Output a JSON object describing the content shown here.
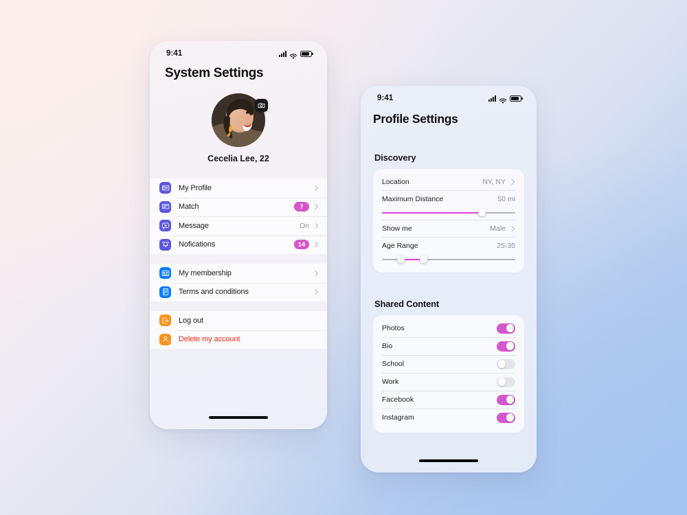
{
  "theme": {
    "bg_start": "#fbeeec",
    "bg_end": "#a4c4ee",
    "badge_color": "#d456c8",
    "toggle_on_color": "#d557cf",
    "slider_fill_color": "#e040e0",
    "icon_indigo": "#5b57e0",
    "icon_blue": "#0a7cff",
    "icon_orange": "#f79420",
    "danger_color": "#f2271c"
  },
  "phone_one": {
    "status": {
      "time": "9:41",
      "signal_icon": "signal-bars-icon",
      "wifi_icon": "wifi-icon",
      "battery_icon": "battery-icon"
    },
    "title": "System Settings",
    "avatar": {
      "name": "avatar",
      "camera_badge": "camera-icon"
    },
    "user_name": "Cecelia Lee, 22",
    "groups": [
      {
        "items": [
          {
            "label": "My Profile",
            "icon": "profile-card-icon",
            "icon_color": "#5b57e0",
            "value": "",
            "badge": "",
            "chevron": true
          },
          {
            "label": "Match",
            "icon": "match-card-icon",
            "icon_color": "#5b57e0",
            "value": "",
            "badge": "7",
            "chevron": true
          },
          {
            "label": "Message",
            "icon": "message-heart-icon",
            "icon_color": "#5b57e0",
            "value": "On",
            "badge": "",
            "chevron": true
          },
          {
            "label": "Nofications",
            "icon": "bell-ring-icon",
            "icon_color": "#5b57e0",
            "value": "",
            "badge": "14",
            "chevron": true
          }
        ]
      },
      {
        "items": [
          {
            "label": "My membership",
            "icon": "membership-card-icon",
            "icon_color": "#0a7cff",
            "value": "",
            "badge": "",
            "chevron": true
          },
          {
            "label": "Terms and conditions",
            "icon": "document-icon",
            "icon_color": "#0a7cff",
            "value": "",
            "badge": "",
            "chevron": true
          }
        ]
      },
      {
        "items": [
          {
            "label": "Log out",
            "icon": "logout-icon",
            "icon_color": "#f79420",
            "value": "",
            "badge": "",
            "chevron": false
          },
          {
            "label": "Delete my account",
            "icon": "delete-account-icon",
            "icon_color": "#f79420",
            "value": "",
            "badge": "",
            "chevron": false,
            "danger": true
          }
        ]
      }
    ],
    "home_indicator": "home-indicator"
  },
  "phone_two": {
    "status": {
      "time": "9:41",
      "signal_icon": "signal-bars-icon",
      "wifi_icon": "wifi-icon",
      "battery_icon": "battery-icon"
    },
    "title": "Profile Settings",
    "discovery": {
      "section_label": "Discovery",
      "location": {
        "label": "Location",
        "value": "NY, NY"
      },
      "max_distance": {
        "label": "Maximum Distance",
        "value": "50 mi",
        "fill_percent": 75
      },
      "show_me": {
        "label": "Show me",
        "value": "Male"
      },
      "age_range": {
        "label": "Age Range",
        "value": "25-35",
        "low_percent": 14,
        "high_percent": 31
      }
    },
    "shared_content": {
      "section_label": "Shared Content",
      "items": [
        {
          "label": "Photos",
          "state": "on"
        },
        {
          "label": "Bio",
          "state": "on"
        },
        {
          "label": "School",
          "state": "off"
        },
        {
          "label": "Work",
          "state": "off"
        },
        {
          "label": "Facebook",
          "state": "on"
        },
        {
          "label": "Instagram",
          "state": "on"
        }
      ]
    },
    "home_indicator": "home-indicator"
  }
}
